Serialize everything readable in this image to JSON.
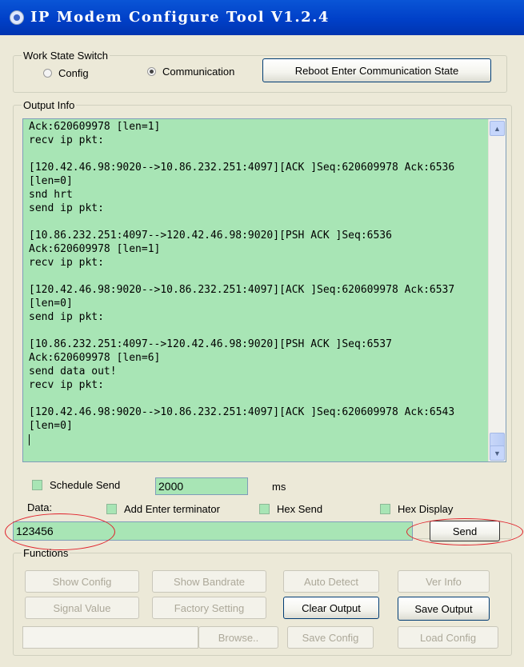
{
  "window": {
    "title": "IP Modem Configure Tool V1.2.4",
    "icon": "app-icon"
  },
  "work_state": {
    "legend": "Work State Switch",
    "config_label": "Config",
    "communication_label": "Communication",
    "selected": "Communication",
    "reboot_label": "Reboot Enter Communication State"
  },
  "output": {
    "legend": "Output Info",
    "lines": [
      "Ack:620609978 [len=1]",
      "recv ip pkt:",
      "",
      "[120.42.46.98:9020-->10.86.232.251:4097][ACK ]Seq:620609978 Ack:6536",
      "[len=0]",
      "snd hrt",
      "send ip pkt:",
      "",
      "[10.86.232.251:4097-->120.42.46.98:9020][PSH ACK ]Seq:6536",
      "Ack:620609978 [len=1]",
      "recv ip pkt:",
      "",
      "[120.42.46.98:9020-->10.86.232.251:4097][ACK ]Seq:620609978 Ack:6537",
      "[len=0]",
      "send ip pkt:",
      "",
      "[10.86.232.251:4097-->120.42.46.98:9020][PSH ACK ]Seq:6537",
      "Ack:620609978 [len=6]",
      "send data out!",
      "recv ip pkt:",
      "",
      "[120.42.46.98:9020-->10.86.232.251:4097][ACK ]Seq:620609978 Ack:6543",
      "[len=0]"
    ]
  },
  "send_panel": {
    "schedule_label": "Schedule Send",
    "schedule_value": "2000",
    "ms_label": "ms",
    "data_label": "Data:",
    "add_enter_label": "Add Enter terminator",
    "hex_send_label": "Hex Send",
    "hex_display_label": "Hex Display",
    "data_value": "123456",
    "send_label": "Send"
  },
  "functions": {
    "legend": "Functions",
    "show_config": "Show Config",
    "show_bandrate": "Show Bandrate",
    "auto_detect": "Auto Detect",
    "ver_info": "Ver Info",
    "signal_value": "Signal Value",
    "factory_setting": "Factory Setting",
    "clear_output": "Clear Output",
    "save_output": "Save Output",
    "config_path": "",
    "browse": "Browse..",
    "save_config": "Save Config",
    "load_config": "Load Config"
  },
  "colors": {
    "field_bg": "#a8e5b5",
    "title_bar": "#0040c8",
    "highlight": "#e0202a"
  }
}
